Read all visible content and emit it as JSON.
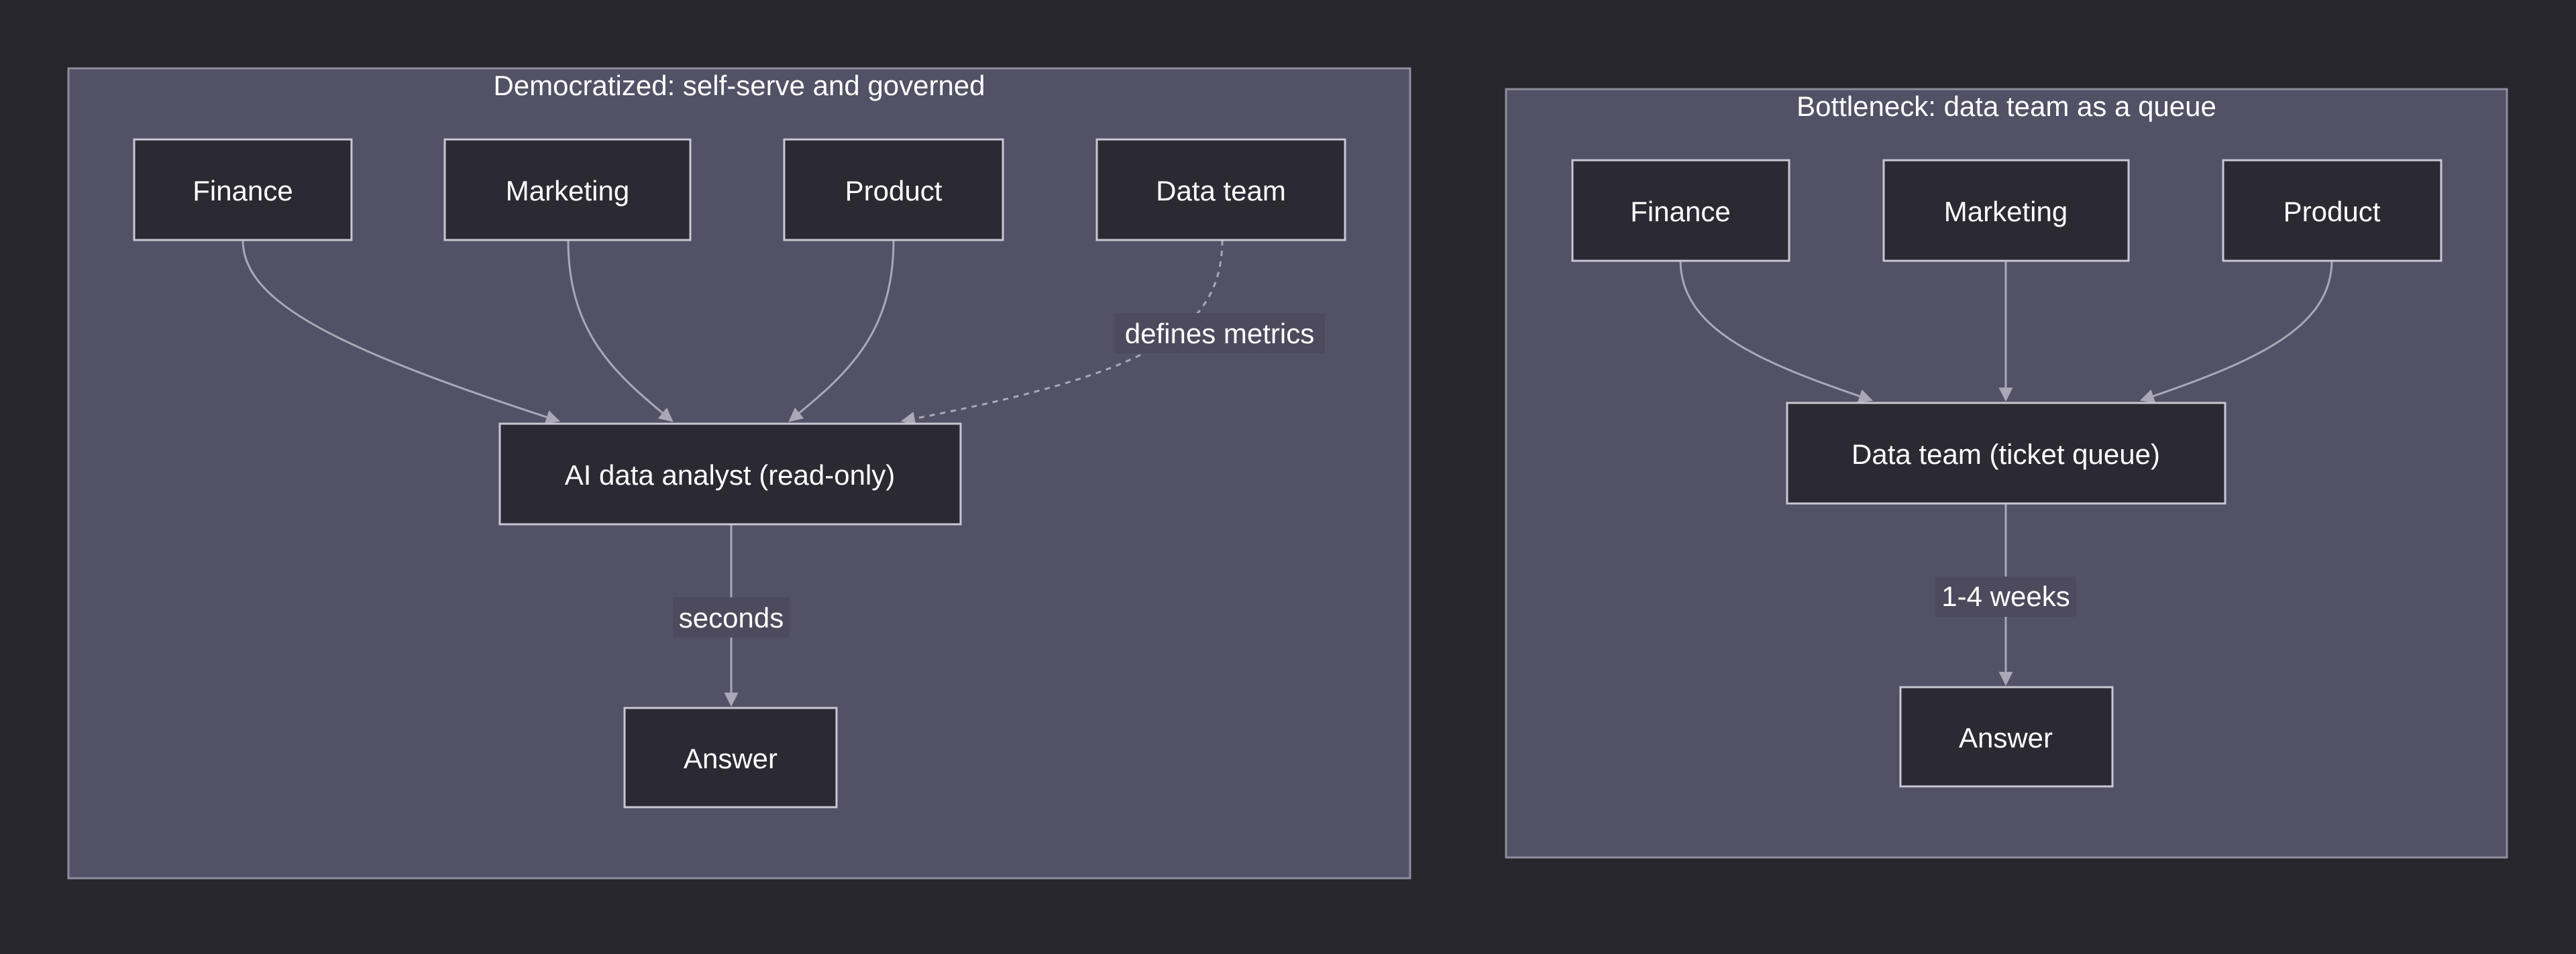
{
  "colors": {
    "background": "#27262d",
    "cluster_fill": "#535166",
    "cluster_stroke": "#8f8d9c",
    "node_fill": "#2b2a33",
    "node_stroke": "#c9c7d3",
    "text": "#ffffff",
    "edge": "#aaa8b6",
    "edge_label_bg": "#4c4a5c"
  },
  "clusters": {
    "democratized": {
      "title": "Democratized: self-serve and governed",
      "nodes": {
        "finance": "Finance",
        "marketing": "Marketing",
        "product": "Product",
        "data_team": "Data team",
        "ai_analyst": "AI data analyst (read-only)",
        "answer": "Answer"
      },
      "edge_labels": {
        "defines": "defines metrics",
        "seconds": "seconds"
      }
    },
    "bottleneck": {
      "title": "Bottleneck: data team as a queue",
      "nodes": {
        "finance": "Finance",
        "marketing": "Marketing",
        "product": "Product",
        "queue": "Data team (ticket queue)",
        "answer": "Answer"
      },
      "edge_labels": {
        "weeks": "1-4 weeks"
      }
    }
  }
}
